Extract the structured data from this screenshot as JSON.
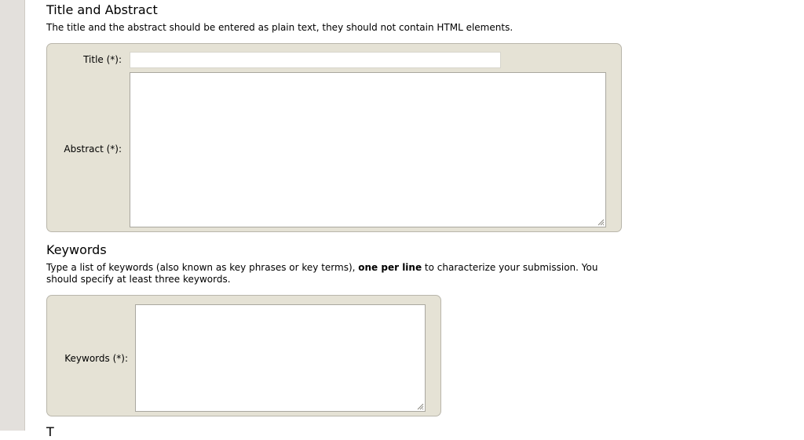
{
  "title_abstract": {
    "heading": "Title and Abstract",
    "description": "The title and the abstract should be entered as plain text, they should not contain HTML elements.",
    "title_label": "Title (*):",
    "title_value": "",
    "abstract_label": "Abstract (*):",
    "abstract_value": ""
  },
  "keywords": {
    "heading": "Keywords",
    "description_before": "Type a list of keywords (also known as key phrases or key terms), ",
    "description_bold": "one per line",
    "description_after": " to characterize your submission. You should specify at least three keywords.",
    "keywords_label": "Keywords (*):",
    "keywords_value": ""
  },
  "next_heading_partial": "T"
}
